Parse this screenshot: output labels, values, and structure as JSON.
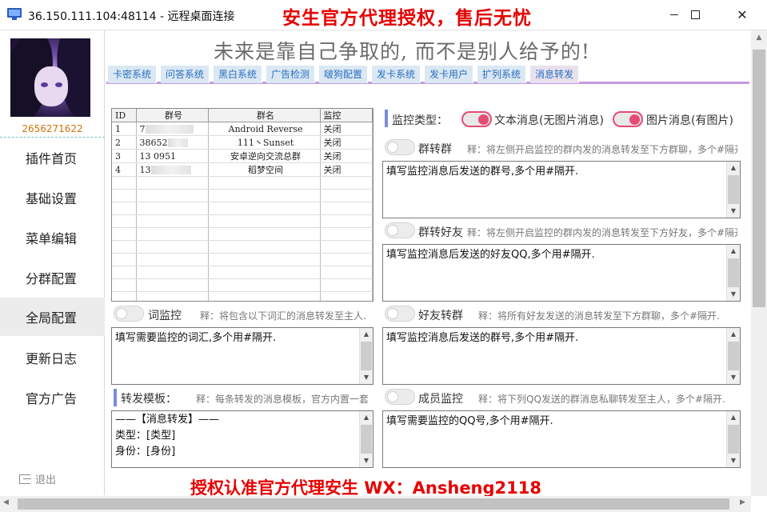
{
  "window": {
    "title": "36.150.111.104:48114 - 远程桌面连接",
    "banner": "安生官方代理授权，售后无忧",
    "footer_banner": "授权认准官方代理安生  WX：Ansheng2118"
  },
  "sidebar": {
    "qq": "2656271622",
    "items": [
      {
        "label": "插件首页"
      },
      {
        "label": "基础设置"
      },
      {
        "label": "菜单编辑"
      },
      {
        "label": "分群配置"
      },
      {
        "label": "全局配置",
        "active": true
      },
      {
        "label": "更新日志"
      },
      {
        "label": "官方广告"
      }
    ],
    "logout": "退出"
  },
  "header": {
    "motto": "未来是靠自己争取的, 而不是别人给予的!"
  },
  "tabs": [
    {
      "label": "卡密系统"
    },
    {
      "label": "问答系统"
    },
    {
      "label": "黑白系统"
    },
    {
      "label": "广告检测"
    },
    {
      "label": "啵狗配置"
    },
    {
      "label": "发卡系统"
    },
    {
      "label": "发卡用户"
    },
    {
      "label": "扩列系统"
    },
    {
      "label": "消息转发",
      "active": true
    }
  ],
  "group_table": {
    "columns": [
      "ID",
      "群号",
      "群名",
      "监控"
    ],
    "rows": [
      {
        "id": "1",
        "group_no": "7",
        "name": "Android Reverse",
        "status": "关闭"
      },
      {
        "id": "2",
        "group_no": "38652",
        "name": "111丶Sunset",
        "status": "关闭"
      },
      {
        "id": "3",
        "group_no": "13   0951",
        "name": "安卓逆向交流总群",
        "status": "关闭"
      },
      {
        "id": "4",
        "group_no": "13",
        "name": "稻梦空间",
        "status": "关闭"
      }
    ]
  },
  "monitor_type": {
    "label": "监控类型：",
    "text_msg": "文本消息(无图片消息)",
    "image_msg": "图片消息(有图片)"
  },
  "sections": {
    "group_to_group": {
      "label": "群转群",
      "note": "释：将左侧开启监控的群内发的消息转发至下方群聊，多个#隔开.",
      "placeholder": "填写监控消息后发送的群号,多个用#隔开."
    },
    "group_to_friend": {
      "label": "群转好友",
      "note": "释：将左侧开启监控的群内发的消息转发至下方好友，多个#隔开.",
      "placeholder": "填写监控消息后发送的好友QQ,多个用#隔开."
    },
    "word_monitor": {
      "label": "词监控",
      "note": "释：将包含以下词汇的消息转发至主人.",
      "placeholder": "填写需要监控的词汇,多个用#隔开."
    },
    "friend_to_group": {
      "label": "好友转群",
      "note": "释：将所有好友发送的消息转发至下方群聊，多个#隔开.",
      "placeholder": "填写监控消息后发送的群号,多个用#隔开."
    },
    "template": {
      "label": "转发模板：",
      "note": "释：每条转发的消息模板，官方内置一套.",
      "content": "——【消息转发】——\n类型：[类型]\n身份：[身份]"
    },
    "member_monitor": {
      "label": "成员监控",
      "note": "释：将下列QQ发送的群消息私聊转发至主人，多个#隔开.",
      "placeholder": "填写需要监控的QQ号,多个用#隔开."
    }
  }
}
